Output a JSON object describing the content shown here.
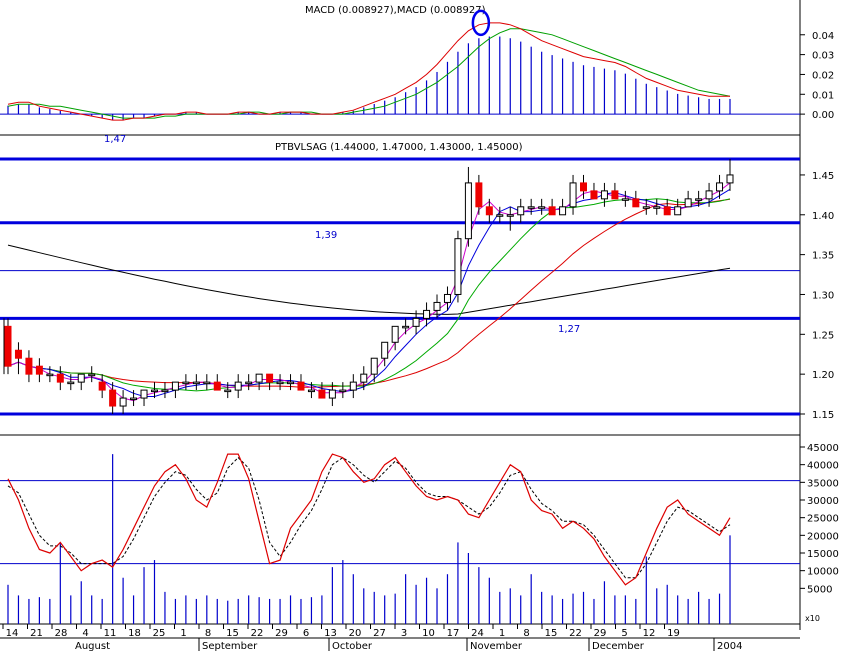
{
  "chart_data": {
    "type": "candlestick",
    "macd_panel": {
      "title": "MACD (0.008927),MACD (0.008927)",
      "y_ticks": [
        "0.04",
        "0.03",
        "0.02",
        "0.01",
        "0.00"
      ],
      "ylim": [
        -0.008,
        0.055
      ],
      "annotation_label": "1,47",
      "macd_line": [
        0.005,
        0.006,
        0.006,
        0.004,
        0.003,
        0.002,
        0.001,
        0.0,
        -0.001,
        -0.002,
        -0.003,
        -0.003,
        -0.002,
        -0.002,
        -0.001,
        0.0,
        0.0,
        0.001,
        0.001,
        0.0,
        0.0,
        0.0,
        0.001,
        0.001,
        0.0,
        0.0,
        0.001,
        0.001,
        0.001,
        0.0,
        0.0,
        0.0,
        0.001,
        0.002,
        0.004,
        0.006,
        0.008,
        0.01,
        0.013,
        0.016,
        0.02,
        0.025,
        0.031,
        0.037,
        0.042,
        0.045,
        0.046,
        0.046,
        0.045,
        0.043,
        0.04,
        0.037,
        0.035,
        0.033,
        0.031,
        0.029,
        0.028,
        0.027,
        0.026,
        0.024,
        0.021,
        0.018,
        0.016,
        0.014,
        0.012,
        0.011,
        0.01,
        0.009,
        0.009,
        0.009
      ],
      "signal_line": [
        0.004,
        0.005,
        0.005,
        0.005,
        0.004,
        0.004,
        0.003,
        0.002,
        0.001,
        0.0,
        -0.001,
        -0.002,
        -0.002,
        -0.002,
        -0.002,
        -0.001,
        -0.001,
        0.0,
        0.0,
        0.0,
        0.0,
        0.0,
        0.0,
        0.001,
        0.001,
        0.0,
        0.0,
        0.001,
        0.001,
        0.001,
        0.0,
        0.0,
        0.0,
        0.001,
        0.002,
        0.003,
        0.004,
        0.006,
        0.008,
        0.01,
        0.013,
        0.016,
        0.02,
        0.024,
        0.029,
        0.034,
        0.038,
        0.041,
        0.043,
        0.043,
        0.042,
        0.041,
        0.04,
        0.038,
        0.036,
        0.034,
        0.032,
        0.03,
        0.028,
        0.026,
        0.024,
        0.022,
        0.02,
        0.018,
        0.016,
        0.014,
        0.012,
        0.011,
        0.01,
        0.009
      ]
    },
    "price_panel": {
      "title": "PTBVLSAG (1.44000, 1.47000, 1.43000, 1.45000)",
      "y_ticks": [
        "1.45",
        "1.40",
        "1.35",
        "1.30",
        "1.25",
        "1.20",
        "1.15"
      ],
      "ylim": [
        1.145,
        1.475
      ],
      "horizontal_levels": [
        1.47,
        1.39,
        1.27,
        1.15
      ],
      "labels": [
        "1,39",
        "1,27"
      ],
      "candles": [
        [
          1.26,
          1.27,
          1.2,
          1.21
        ],
        [
          1.23,
          1.24,
          1.2,
          1.22
        ],
        [
          1.22,
          1.23,
          1.19,
          1.2
        ],
        [
          1.21,
          1.22,
          1.19,
          1.2
        ],
        [
          1.2,
          1.21,
          1.19,
          1.2
        ],
        [
          1.2,
          1.21,
          1.18,
          1.19
        ],
        [
          1.19,
          1.2,
          1.18,
          1.19
        ],
        [
          1.19,
          1.2,
          1.18,
          1.2
        ],
        [
          1.2,
          1.21,
          1.19,
          1.2
        ],
        [
          1.19,
          1.2,
          1.17,
          1.18
        ],
        [
          1.18,
          1.19,
          1.15,
          1.16
        ],
        [
          1.16,
          1.18,
          1.15,
          1.17
        ],
        [
          1.17,
          1.18,
          1.16,
          1.17
        ],
        [
          1.17,
          1.18,
          1.16,
          1.18
        ],
        [
          1.18,
          1.19,
          1.17,
          1.18
        ],
        [
          1.18,
          1.19,
          1.17,
          1.18
        ],
        [
          1.18,
          1.19,
          1.17,
          1.19
        ],
        [
          1.19,
          1.2,
          1.18,
          1.19
        ],
        [
          1.19,
          1.2,
          1.18,
          1.19
        ],
        [
          1.19,
          1.2,
          1.18,
          1.19
        ],
        [
          1.19,
          1.2,
          1.18,
          1.18
        ],
        [
          1.18,
          1.19,
          1.17,
          1.18
        ],
        [
          1.18,
          1.2,
          1.17,
          1.19
        ],
        [
          1.19,
          1.2,
          1.18,
          1.19
        ],
        [
          1.19,
          1.2,
          1.18,
          1.2
        ],
        [
          1.2,
          1.2,
          1.18,
          1.19
        ],
        [
          1.19,
          1.2,
          1.18,
          1.19
        ],
        [
          1.19,
          1.2,
          1.18,
          1.19
        ],
        [
          1.19,
          1.2,
          1.18,
          1.18
        ],
        [
          1.18,
          1.19,
          1.17,
          1.18
        ],
        [
          1.18,
          1.19,
          1.17,
          1.17
        ],
        [
          1.17,
          1.19,
          1.16,
          1.18
        ],
        [
          1.18,
          1.19,
          1.17,
          1.18
        ],
        [
          1.18,
          1.2,
          1.17,
          1.19
        ],
        [
          1.19,
          1.21,
          1.18,
          1.2
        ],
        [
          1.2,
          1.22,
          1.19,
          1.22
        ],
        [
          1.22,
          1.24,
          1.21,
          1.24
        ],
        [
          1.24,
          1.26,
          1.23,
          1.26
        ],
        [
          1.26,
          1.27,
          1.25,
          1.26
        ],
        [
          1.26,
          1.28,
          1.25,
          1.27
        ],
        [
          1.27,
          1.29,
          1.26,
          1.28
        ],
        [
          1.28,
          1.3,
          1.27,
          1.29
        ],
        [
          1.29,
          1.31,
          1.28,
          1.3
        ],
        [
          1.3,
          1.38,
          1.29,
          1.37
        ],
        [
          1.37,
          1.46,
          1.36,
          1.44
        ],
        [
          1.44,
          1.45,
          1.4,
          1.41
        ],
        [
          1.41,
          1.42,
          1.39,
          1.4
        ],
        [
          1.4,
          1.41,
          1.39,
          1.4
        ],
        [
          1.4,
          1.41,
          1.38,
          1.4
        ],
        [
          1.4,
          1.42,
          1.39,
          1.41
        ],
        [
          1.41,
          1.42,
          1.4,
          1.41
        ],
        [
          1.41,
          1.42,
          1.4,
          1.41
        ],
        [
          1.41,
          1.42,
          1.4,
          1.4
        ],
        [
          1.4,
          1.42,
          1.4,
          1.41
        ],
        [
          1.41,
          1.45,
          1.4,
          1.44
        ],
        [
          1.44,
          1.45,
          1.42,
          1.43
        ],
        [
          1.43,
          1.44,
          1.42,
          1.42
        ],
        [
          1.42,
          1.44,
          1.41,
          1.43
        ],
        [
          1.43,
          1.44,
          1.42,
          1.42
        ],
        [
          1.42,
          1.43,
          1.41,
          1.42
        ],
        [
          1.42,
          1.43,
          1.41,
          1.41
        ],
        [
          1.41,
          1.42,
          1.4,
          1.41
        ],
        [
          1.41,
          1.42,
          1.4,
          1.41
        ],
        [
          1.41,
          1.42,
          1.4,
          1.4
        ],
        [
          1.4,
          1.42,
          1.4,
          1.41
        ],
        [
          1.41,
          1.43,
          1.41,
          1.42
        ],
        [
          1.42,
          1.43,
          1.41,
          1.42
        ],
        [
          1.42,
          1.44,
          1.41,
          1.43
        ],
        [
          1.43,
          1.45,
          1.42,
          1.44
        ],
        [
          1.44,
          1.47,
          1.43,
          1.45
        ]
      ]
    },
    "oscillator_panel": {
      "y_ticks": [
        "45000",
        "40000",
        "35000",
        "30000",
        "25000",
        "20000",
        "15000",
        "10000",
        "5000"
      ],
      "ylim": [
        0,
        45000
      ],
      "scale_label": "x10",
      "horizontal_levels": [
        35500,
        12000
      ],
      "volume": [
        6000,
        3000,
        2000,
        2500,
        2000,
        18000,
        3000,
        7000,
        3000,
        2000,
        43000,
        8000,
        3000,
        11000,
        13000,
        4000,
        2000,
        3000,
        2000,
        3000,
        2000,
        1500,
        2000,
        3000,
        2500,
        2000,
        2000,
        3000,
        2000,
        2500,
        3000,
        11000,
        13000,
        9000,
        5000,
        4000,
        3000,
        3500,
        9000,
        6000,
        8000,
        5000,
        9000,
        18000,
        15000,
        11000,
        8000,
        4000,
        5000,
        3000,
        9000,
        4000,
        3000,
        2000,
        3500,
        4000,
        2000,
        7000,
        3000,
        3000,
        2000,
        14000,
        5000,
        6000,
        3000,
        2000,
        4000,
        2000,
        3500,
        20000
      ],
      "stoch_k": [
        36000,
        30000,
        22000,
        16000,
        15000,
        18000,
        14000,
        10000,
        12000,
        13000,
        11000,
        16000,
        22000,
        28000,
        34000,
        38000,
        40000,
        36000,
        30000,
        28000,
        35000,
        43000,
        43000,
        36000,
        24000,
        12000,
        13000,
        22000,
        26000,
        30000,
        38000,
        43000,
        42000,
        38000,
        35000,
        36000,
        40000,
        42000,
        38000,
        34000,
        31000,
        30000,
        31000,
        30000,
        26000,
        25000,
        30000,
        35000,
        40000,
        38000,
        30000,
        27000,
        26000,
        22000,
        24000,
        22000,
        19000,
        14000,
        10000,
        6000,
        8000,
        15000,
        22000,
        28000,
        30000,
        26000,
        24000,
        22000,
        20000,
        25000
      ],
      "stoch_d": [
        34000,
        32000,
        26000,
        20000,
        17000,
        17000,
        15000,
        12000,
        12000,
        12000,
        12000,
        14000,
        19000,
        25000,
        31000,
        35000,
        38000,
        37000,
        33000,
        30000,
        32000,
        39000,
        42000,
        39000,
        30000,
        18000,
        14000,
        18000,
        23000,
        27000,
        33000,
        40000,
        42000,
        40000,
        37000,
        35000,
        38000,
        41000,
        39000,
        35000,
        32000,
        31000,
        31000,
        30000,
        28000,
        26000,
        28000,
        32000,
        37000,
        38000,
        33000,
        29000,
        27000,
        24000,
        24000,
        23000,
        20000,
        16000,
        12000,
        8000,
        8000,
        12000,
        18000,
        24000,
        28000,
        27000,
        25000,
        23000,
        21000,
        23000
      ]
    },
    "x_tick_labels": [
      "14",
      "21",
      "28",
      "4",
      "11",
      "18",
      "25",
      "1",
      "8",
      "15",
      "22",
      "29",
      "6",
      "13",
      "20",
      "27",
      "3",
      "10",
      "17",
      "24",
      "1",
      "8",
      "15",
      "22",
      "29",
      "5",
      "12",
      "19"
    ],
    "month_labels": [
      "August",
      "September",
      "October",
      "November",
      "December",
      "2004"
    ]
  }
}
